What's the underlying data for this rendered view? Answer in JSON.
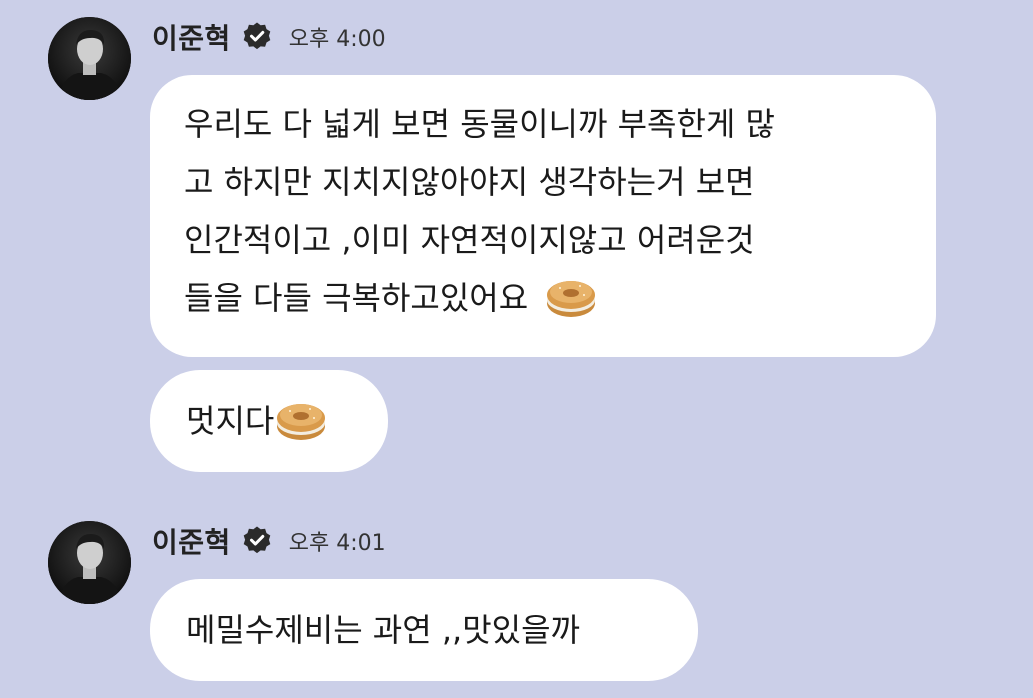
{
  "messages": [
    {
      "sender": "이준혁",
      "time": "오후 4:00",
      "verified_icon": "verified-badge-icon",
      "bubbles": [
        {
          "lines": [
            "우리도 다 넓게 보면 동물이니까 부족한게 많",
            "고 하지만 지치지않아야지 생각하는거 보면",
            "인간적이고 ,이미 자연적이지않고 어려운것",
            "들을 다들 극복하고있어요"
          ],
          "emoji": "bagel-emoji"
        },
        {
          "text": "멋지다",
          "emoji": "bagel-emoji"
        }
      ]
    },
    {
      "sender": "이준혁",
      "time": "오후 4:01",
      "verified_icon": "verified-badge-icon",
      "bubbles": [
        {
          "text": "메밀수제비는 과연 ,,맛있을까"
        }
      ]
    }
  ],
  "colors": {
    "background": "#cbcfe8",
    "bubble": "#ffffff",
    "text": "#1a1a1a",
    "badge": "#2b2b2b"
  }
}
